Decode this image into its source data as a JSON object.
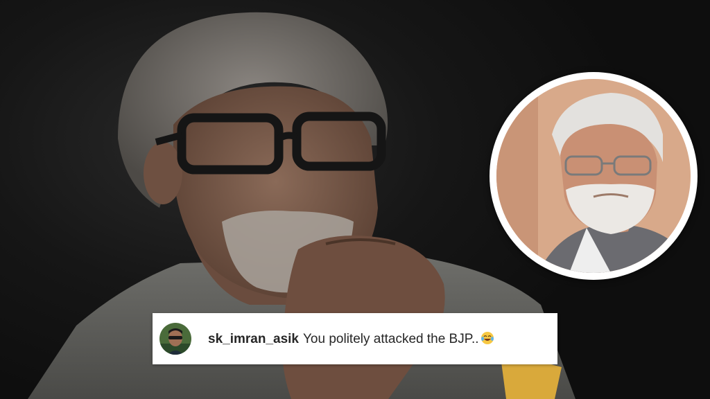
{
  "comment": {
    "username": "sk_imran_asik",
    "text": "You politely attacked the BJP..",
    "emoji": "face-with-tears-of-joy-icon"
  },
  "colors": {
    "background": "#121212",
    "card": "#ffffff",
    "text": "#262626",
    "emoji": "#f7c843"
  }
}
